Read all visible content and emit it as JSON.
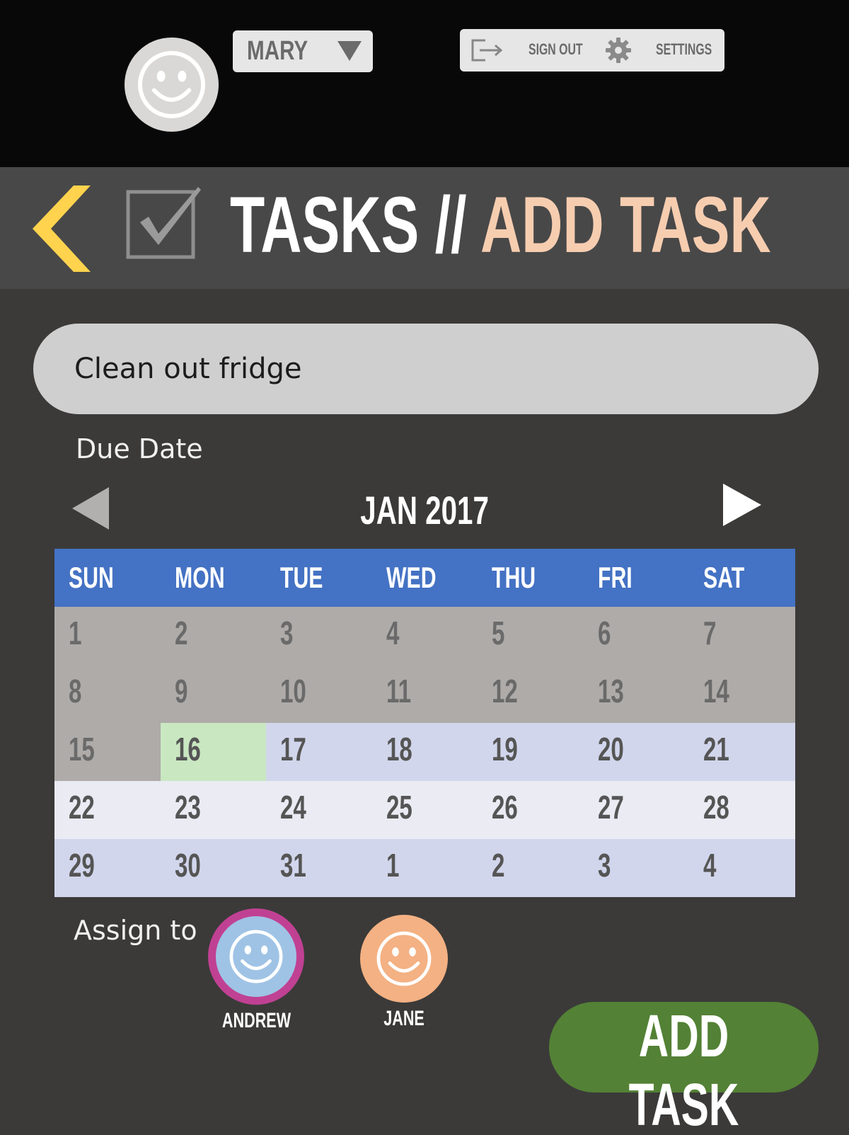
{
  "user": {
    "name": "MARY"
  },
  "account": {
    "sign_out_label": "SIGN OUT",
    "settings_label": "SETTINGS"
  },
  "header": {
    "section": "TASKS //",
    "page": "ADD TASK"
  },
  "task_input": {
    "value": "Clean out fridge"
  },
  "due_date": {
    "label": "Due Date",
    "month_label": "JAN 2017",
    "weekdays": [
      "SUN",
      "MON",
      "TUE",
      "WED",
      "THU",
      "FRI",
      "SAT"
    ],
    "weeks": [
      [
        "1",
        "2",
        "3",
        "4",
        "5",
        "6",
        "7"
      ],
      [
        "8",
        "9",
        "10",
        "11",
        "12",
        "13",
        "14"
      ],
      [
        "15",
        "16",
        "17",
        "18",
        "19",
        "20",
        "21"
      ],
      [
        "22",
        "23",
        "24",
        "25",
        "26",
        "27",
        "28"
      ],
      [
        "29",
        "30",
        "31",
        "1",
        "2",
        "3",
        "4"
      ]
    ],
    "selected_day": "16"
  },
  "assign": {
    "label": "Assign to",
    "people": [
      {
        "name": "ANDREW",
        "color": "#9fc3e5",
        "selected": true,
        "ring_color": "#c04193"
      },
      {
        "name": "JANE",
        "color": "#f4b183",
        "selected": false
      }
    ]
  },
  "actions": {
    "add_task_label": "ADD TASK"
  },
  "colors": {
    "accent_back": "#ffd34d",
    "title_highlight": "#f7cdb0",
    "calendar_header": "#4472c4",
    "selected_day": "#c9e7c1",
    "add_button": "#538135"
  },
  "icons": [
    "smiley-icon",
    "caret-down-icon",
    "sign-out-icon",
    "gear-icon",
    "back-chevron-icon",
    "checkbox-icon",
    "prev-triangle-icon",
    "next-triangle-icon"
  ]
}
